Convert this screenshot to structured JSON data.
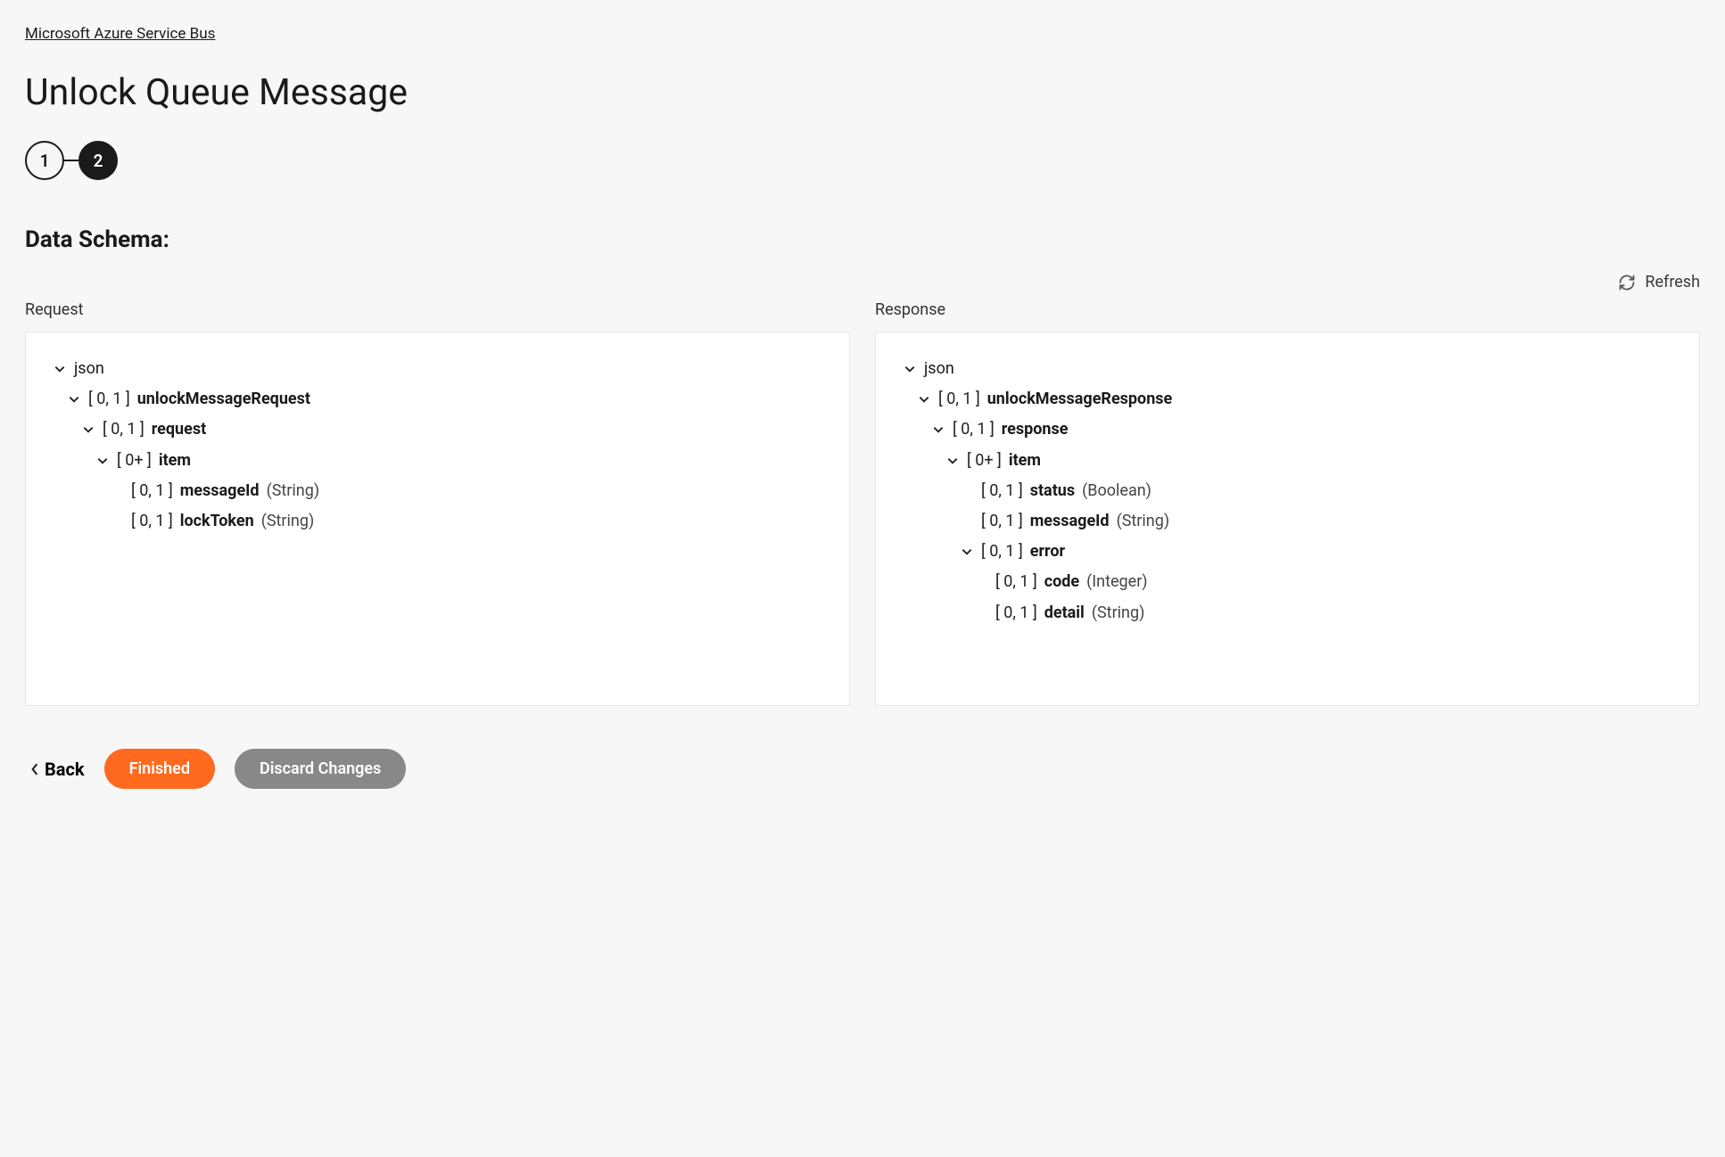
{
  "breadcrumb": "Microsoft Azure Service Bus",
  "title": "Unlock Queue Message",
  "stepper": {
    "step1": "1",
    "step2": "2"
  },
  "section_title": "Data Schema:",
  "refresh_label": "Refresh",
  "request_label": "Request",
  "response_label": "Response",
  "req": {
    "root": "json",
    "l1_card": "[ 0, 1 ]",
    "l1_name": "unlockMessageRequest",
    "l2_card": "[ 0, 1 ]",
    "l2_name": "request",
    "l3_card": "[ 0+ ]",
    "l3_name": "item",
    "f1_card": "[ 0, 1 ]",
    "f1_name": "messageId",
    "f1_type": "(String)",
    "f2_card": "[ 0, 1 ]",
    "f2_name": "lockToken",
    "f2_type": "(String)"
  },
  "res": {
    "root": "json",
    "l1_card": "[ 0, 1 ]",
    "l1_name": "unlockMessageResponse",
    "l2_card": "[ 0, 1 ]",
    "l2_name": "response",
    "l3_card": "[ 0+ ]",
    "l3_name": "item",
    "f1_card": "[ 0, 1 ]",
    "f1_name": "status",
    "f1_type": "(Boolean)",
    "f2_card": "[ 0, 1 ]",
    "f2_name": "messageId",
    "f2_type": "(String)",
    "err_card": "[ 0, 1 ]",
    "err_name": "error",
    "e1_card": "[ 0, 1 ]",
    "e1_name": "code",
    "e1_type": "(Integer)",
    "e2_card": "[ 0, 1 ]",
    "e2_name": "detail",
    "e2_type": "(String)"
  },
  "footer": {
    "back": "Back",
    "finished": "Finished",
    "discard": "Discard Changes"
  }
}
